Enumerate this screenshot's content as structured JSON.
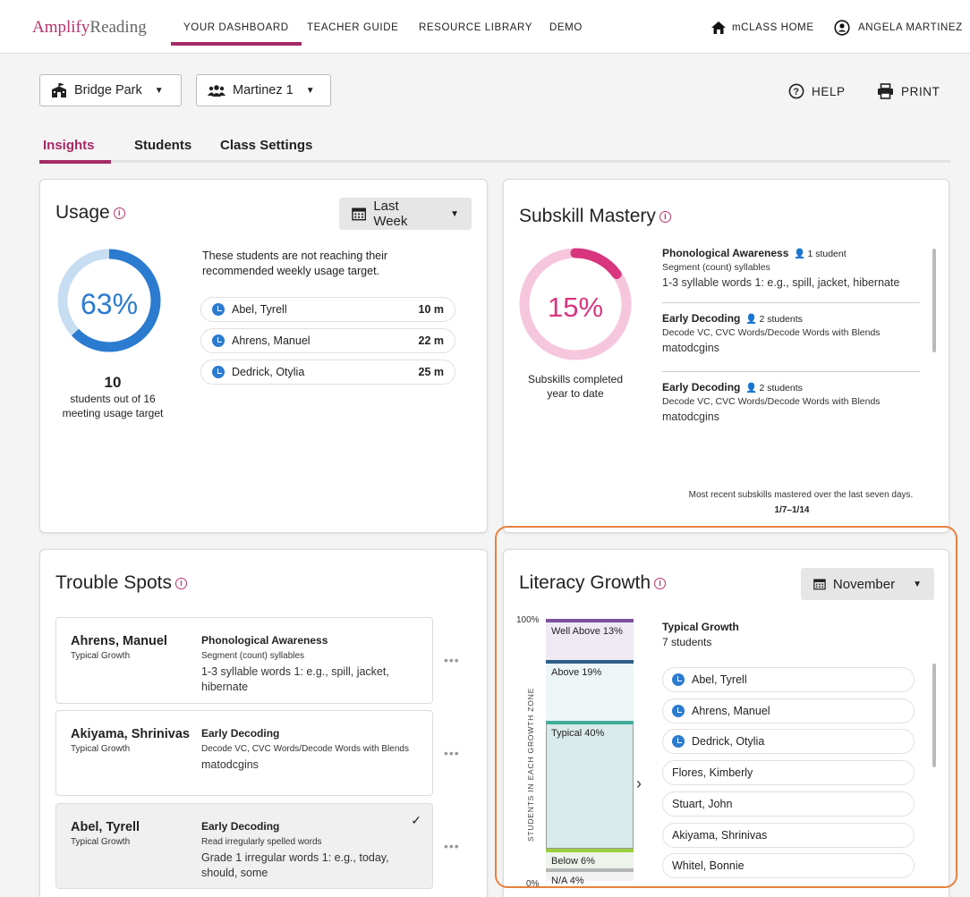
{
  "nav": {
    "brand_primary": "Amplify",
    "brand_secondary": "Reading",
    "links": [
      "YOUR DASHBOARD",
      "TEACHER GUIDE",
      "RESOURCE LIBRARY",
      "DEMO"
    ],
    "home": "mCLASS HOME",
    "user": "ANGELA MARTINEZ"
  },
  "toolbar": {
    "school": "Bridge Park",
    "class_name": "Martinez 1",
    "help": "HELP",
    "print": "PRINT"
  },
  "tabs": [
    "Insights",
    "Students",
    "Class Settings"
  ],
  "usage": {
    "title": "Usage",
    "period": "Last Week",
    "percent_label": "63%",
    "percent": 0.63,
    "count": "10",
    "count_desc_1": "students out of 16",
    "count_desc_2": "meeting usage target",
    "message": "These students are not reaching their recommended weekly usage target.",
    "students": [
      {
        "name": "Abel, Tyrell",
        "time": "10 m"
      },
      {
        "name": "Ahrens, Manuel",
        "time": "22 m"
      },
      {
        "name": "Dedrick, Otylia",
        "time": "25 m"
      }
    ]
  },
  "subskill": {
    "title": "Subskill Mastery",
    "percent_label": "15%",
    "percent": 0.15,
    "caption_1": "Subskills completed",
    "caption_2": "year to date",
    "items": [
      {
        "skill": "Phonological Awareness",
        "count": "1 student",
        "desc1": "Segment (count) syllables",
        "desc2": "1-3 syllable words 1: e.g., spill, jacket, hibernate"
      },
      {
        "skill": "Early Decoding",
        "count": "2 students",
        "desc1": "Decode VC, CVC Words/Decode Words with Blends",
        "desc2": "matodcgins"
      },
      {
        "skill": "Early Decoding",
        "count": "2 students",
        "desc1": "Decode VC, CVC Words/Decode Words with Blends",
        "desc2": "matodcgins"
      }
    ],
    "footer": "Most recent subskills mastered over the last seven days.",
    "date_range": "1/7–1/14"
  },
  "trouble": {
    "title": "Trouble Spots",
    "items": [
      {
        "name": "Ahrens, Manuel",
        "growth": "Typical Growth",
        "skill": "Phonological Awareness",
        "desc1": "Segment (count) syllables",
        "desc2": "1-3 syllable words 1: e.g., spill, jacket, hibernate"
      },
      {
        "name": "Akiyama, Shrinivas",
        "growth": "Typical Growth",
        "skill": "Early Decoding",
        "desc1": "Decode VC, CVC Words/Decode Words with Blends",
        "desc2": "matodcgins"
      },
      {
        "name": "Abel, Tyrell",
        "growth": "Typical Growth",
        "skill": "Early Decoding",
        "desc1": "Read irregularly spelled words",
        "desc2": "Grade 1 irregular words 1: e.g., today, should, some"
      }
    ],
    "more": "•••",
    "check": "✓"
  },
  "growth": {
    "title": "Literacy Growth",
    "month": "November",
    "y_top": "100%",
    "y_bottom": "0%",
    "axis_label": "STUDENTS IN EACH GROWTH ZONE",
    "zones": [
      {
        "label": "Well Above 13%",
        "value": 13,
        "color": "#7b4fa0"
      },
      {
        "label": "Above 19%",
        "value": 19,
        "color": "#2d5f8a"
      },
      {
        "label": "Typical 40%",
        "value": 40,
        "color": "#3fae9a"
      },
      {
        "label": "Below 6%",
        "value": 6,
        "color": "#9bcd3a"
      },
      {
        "label": "N/A 4%",
        "value": 4,
        "color": "#b5b5b5"
      }
    ],
    "selected_zone": "Typical Growth",
    "selected_count": "7 students",
    "students": [
      {
        "name": "Abel, Tyrell",
        "flag": true
      },
      {
        "name": "Ahrens, Manuel",
        "flag": true
      },
      {
        "name": "Dedrick, Otylia",
        "flag": true
      },
      {
        "name": "Flores, Kimberly",
        "flag": false
      },
      {
        "name": "Stuart, John",
        "flag": false
      },
      {
        "name": "Akiyama, Shrinivas",
        "flag": false
      },
      {
        "name": "Whitel, Bonnie",
        "flag": false
      }
    ]
  }
}
